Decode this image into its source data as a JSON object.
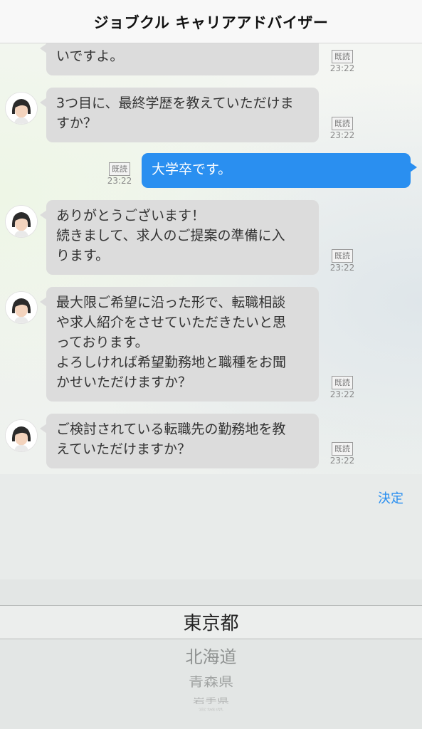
{
  "header": {
    "title": "ジョブクル キャリアアドバイザー"
  },
  "messages": [
    {
      "lines": [
        "いですよ。"
      ],
      "read": "既読",
      "time": "23:22"
    },
    {
      "lines": [
        "3つ目に、最終学歴を教えていただけま",
        "すか？"
      ],
      "read": "既読",
      "time": "23:22"
    },
    {
      "lines": [
        "大学卒です。"
      ],
      "read": "既読",
      "time": "23:22"
    },
    {
      "lines": [
        "ありがとうございます！",
        "続きまして、求人のご提案の準備に入",
        "ります。"
      ],
      "read": "既読",
      "time": "23:22"
    },
    {
      "lines": [
        "最大限ご希望に沿った形で、転職相談",
        "や求人紹介をさせていただきたいと思",
        "っております。",
        "よろしければ希望勤務地と職種をお聞",
        "かせいただけますか？"
      ],
      "read": "既読",
      "time": "23:22"
    },
    {
      "lines": [
        "ご検討されている転職先の勤務地を教",
        "えていただけますか？"
      ],
      "read": "既読",
      "time": "23:22"
    }
  ],
  "picker": {
    "done_label": "決定",
    "selected": "東京都",
    "options_below": [
      "北海道",
      "青森県",
      "岩手県",
      "宮城県"
    ]
  },
  "colors": {
    "accent": "#2a8ff0",
    "incoming_bubble": "#dcdcdc",
    "outgoing_bubble": "#2a8ff0"
  }
}
